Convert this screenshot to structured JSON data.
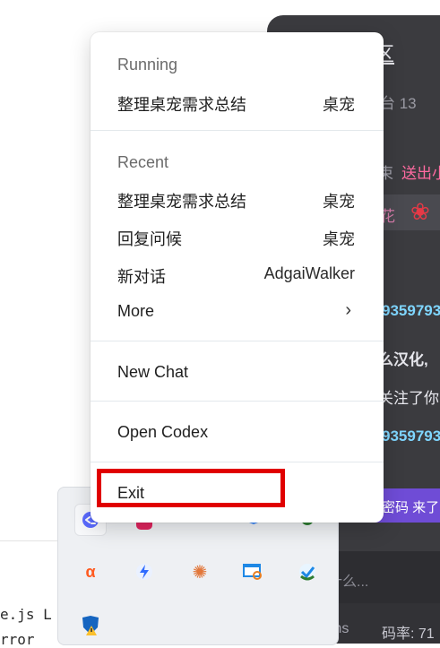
{
  "menu": {
    "running_header": "Running",
    "running_items": [
      {
        "label": "整理桌宠需求总结",
        "tag": "桌宠"
      }
    ],
    "recent_header": "Recent",
    "recent_items": [
      {
        "label": "整理桌宠需求总结",
        "tag": "桌宠"
      },
      {
        "label": "回复问候",
        "tag": "桌宠"
      },
      {
        "label": "新对话",
        "tag": "AdgaiWalker"
      }
    ],
    "more_label": "More",
    "more_chevron": "›",
    "new_chat_label": "New Chat",
    "open_codex_label": "Open Codex",
    "exit_label": "Exit",
    "highlight_color": "#e00000"
  },
  "background_chat": {
    "title_fragment": "区",
    "subtitle_fragment": "台 13",
    "line1_a": "束",
    "line1_b": "送出小",
    "gift_text": "花",
    "user_id_1": "9359793",
    "message_1": "么汉化,",
    "message_2": "关注了你",
    "user_id_2": "9359793",
    "pill_text": "密码 来了",
    "input_placeholder": "什么...",
    "status_a": "ms",
    "status_b": "码率: 71"
  },
  "background_code": {
    "line1": "e.js L",
    "line2": "rror"
  },
  "tray_icons": [
    "codex-icon",
    "instagram-like-icon",
    "blue-app-icon",
    "shield-app-icon",
    "messenger-app-icon",
    "alpha-app-icon",
    "lightning-app-icon",
    "sunburst-app-icon",
    "screen-search-icon",
    "check-app-icon",
    "windows-security-warning-icon"
  ]
}
